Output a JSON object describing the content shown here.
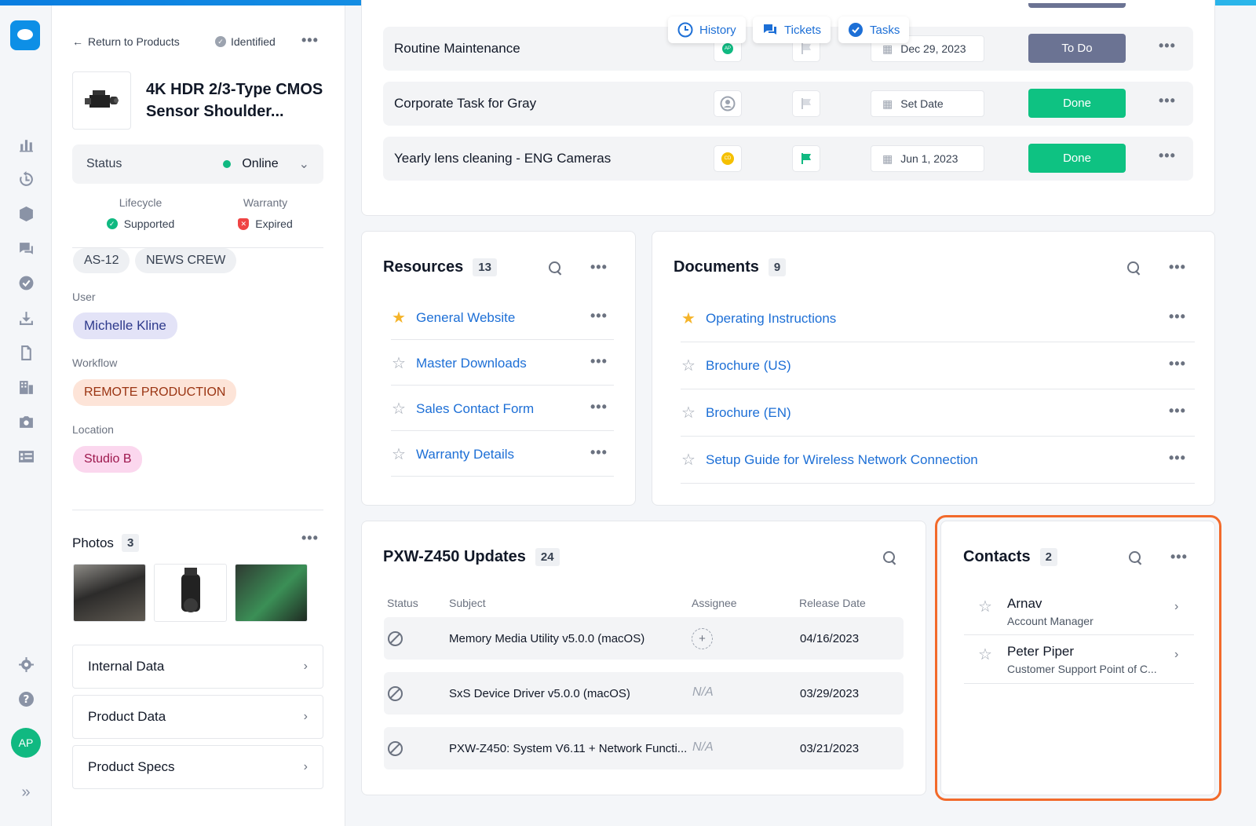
{
  "colors": {
    "accent": "#1d6fd6",
    "highlight": "#f26a2b",
    "done": "#0ec282",
    "todo": "#6b7393",
    "online": "#10b981"
  },
  "header": {
    "back_label": "Return to Products",
    "identified_label": "Identified",
    "more": "•••"
  },
  "product": {
    "title": "4K HDR 2/3-Type CMOS Sensor Shoulder...",
    "status_label": "Status",
    "status_value": "Online"
  },
  "lifecycle": {
    "label": "Lifecycle",
    "value": "Supported"
  },
  "warranty": {
    "label": "Warranty",
    "value": "Expired"
  },
  "tags": [
    "AS-12",
    "NEWS CREW"
  ],
  "fields": {
    "user_label": "User",
    "user_value": "Michelle Kline",
    "workflow_label": "Workflow",
    "workflow_value": "REMOTE PRODUCTION",
    "location_label": "Location",
    "location_value": "Studio B"
  },
  "photos": {
    "label": "Photos",
    "count": "3"
  },
  "accordions": [
    "Internal Data",
    "Product Data",
    "Product Specs"
  ],
  "tabs": [
    {
      "label": "History",
      "icon": "clock-icon"
    },
    {
      "label": "Tickets",
      "icon": "chat-icon"
    },
    {
      "label": "Tasks",
      "icon": "check-circle-icon"
    }
  ],
  "tasks": [
    {
      "name": "Routine Maintenance",
      "assignee": "AP",
      "date": "Dec 29, 2023",
      "status": "To Do"
    },
    {
      "name": "Corporate Task for Gray",
      "assignee": "",
      "date": "Set Date",
      "status": "Done"
    },
    {
      "name": "Yearly lens cleaning - ENG Cameras",
      "assignee": "CD",
      "date": "Jun 1, 2023",
      "status": "Done"
    }
  ],
  "resources": {
    "title": "Resources",
    "count": "13",
    "items": [
      {
        "label": "General Website",
        "starred": true
      },
      {
        "label": "Master Downloads",
        "starred": false
      },
      {
        "label": "Sales Contact Form",
        "starred": false
      },
      {
        "label": "Warranty Details",
        "starred": false
      }
    ]
  },
  "documents": {
    "title": "Documents",
    "count": "9",
    "items": [
      {
        "label": "Operating Instructions",
        "starred": true
      },
      {
        "label": "Brochure (US)",
        "starred": false
      },
      {
        "label": "Brochure (EN)",
        "starred": false
      },
      {
        "label": "Setup Guide for Wireless Network Connection",
        "starred": false
      }
    ]
  },
  "updates": {
    "title": "PXW-Z450 Updates",
    "count": "24",
    "columns": [
      "Status",
      "Subject",
      "Assignee",
      "Release Date"
    ],
    "rows": [
      {
        "subject": "Memory Media Utility v5.0.0 (macOS)",
        "assignee": "+",
        "date": "04/16/2023"
      },
      {
        "subject": "SxS Device Driver v5.0.0 (macOS)",
        "assignee": "N/A",
        "date": "03/29/2023"
      },
      {
        "subject": "PXW-Z450: System V6.11 + Network Functi...",
        "assignee": "N/A",
        "date": "03/21/2023"
      }
    ]
  },
  "contacts": {
    "title": "Contacts",
    "count": "2",
    "items": [
      {
        "name": "Arnav",
        "role": "Account Manager"
      },
      {
        "name": "Peter Piper",
        "role": "Customer Support Point of C..."
      }
    ]
  },
  "user_avatar": "AP"
}
